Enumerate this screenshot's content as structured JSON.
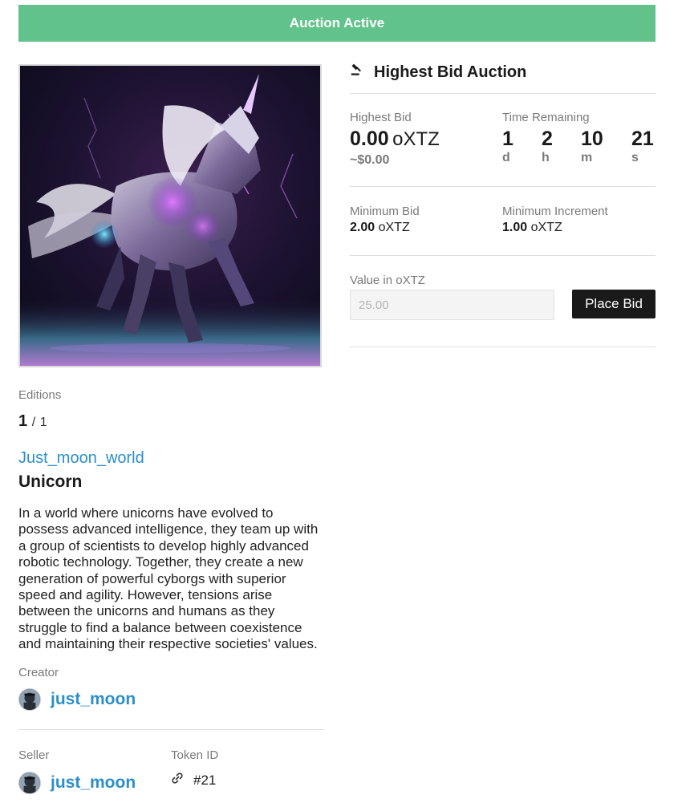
{
  "banner": {
    "status": "Auction Active",
    "color": "#62c28b"
  },
  "artwork": {
    "alt": "Unicorn"
  },
  "editions": {
    "label": "Editions",
    "current": "1",
    "separator": "/",
    "total": "1"
  },
  "collection": {
    "name": "Just_moon_world"
  },
  "token": {
    "title": "Unicorn",
    "description": "In a world where unicorns have evolved to possess advanced intelligence, they team up with a group of scientists to develop highly advanced robotic technology. Together, they create a new generation of powerful cyborgs with superior speed and agility. However, tensions arise between the unicorns and humans as they struggle to find a balance between coexistence and maintaining their respective societies' values.",
    "id_label": "Token ID",
    "id_value": "#21"
  },
  "creator": {
    "label": "Creator",
    "name": "just_moon"
  },
  "seller": {
    "label": "Seller",
    "name": "just_moon"
  },
  "auction": {
    "heading": "Highest Bid Auction",
    "highest_bid_label": "Highest Bid",
    "highest_bid_value": "0.00",
    "currency": "oXTZ",
    "highest_bid_usd": "~$0.00",
    "time_label": "Time Remaining",
    "time": [
      {
        "value": "1",
        "unit": "d"
      },
      {
        "value": "2",
        "unit": "h"
      },
      {
        "value": "10",
        "unit": "m"
      },
      {
        "value": "21",
        "unit": "s"
      }
    ],
    "min_bid_label": "Minimum Bid",
    "min_bid_value": "2.00",
    "min_increment_label": "Minimum Increment",
    "min_increment_value": "1.00",
    "value_in_label": "Value in",
    "input_placeholder": "25.00",
    "place_bid_label": "Place Bid"
  }
}
